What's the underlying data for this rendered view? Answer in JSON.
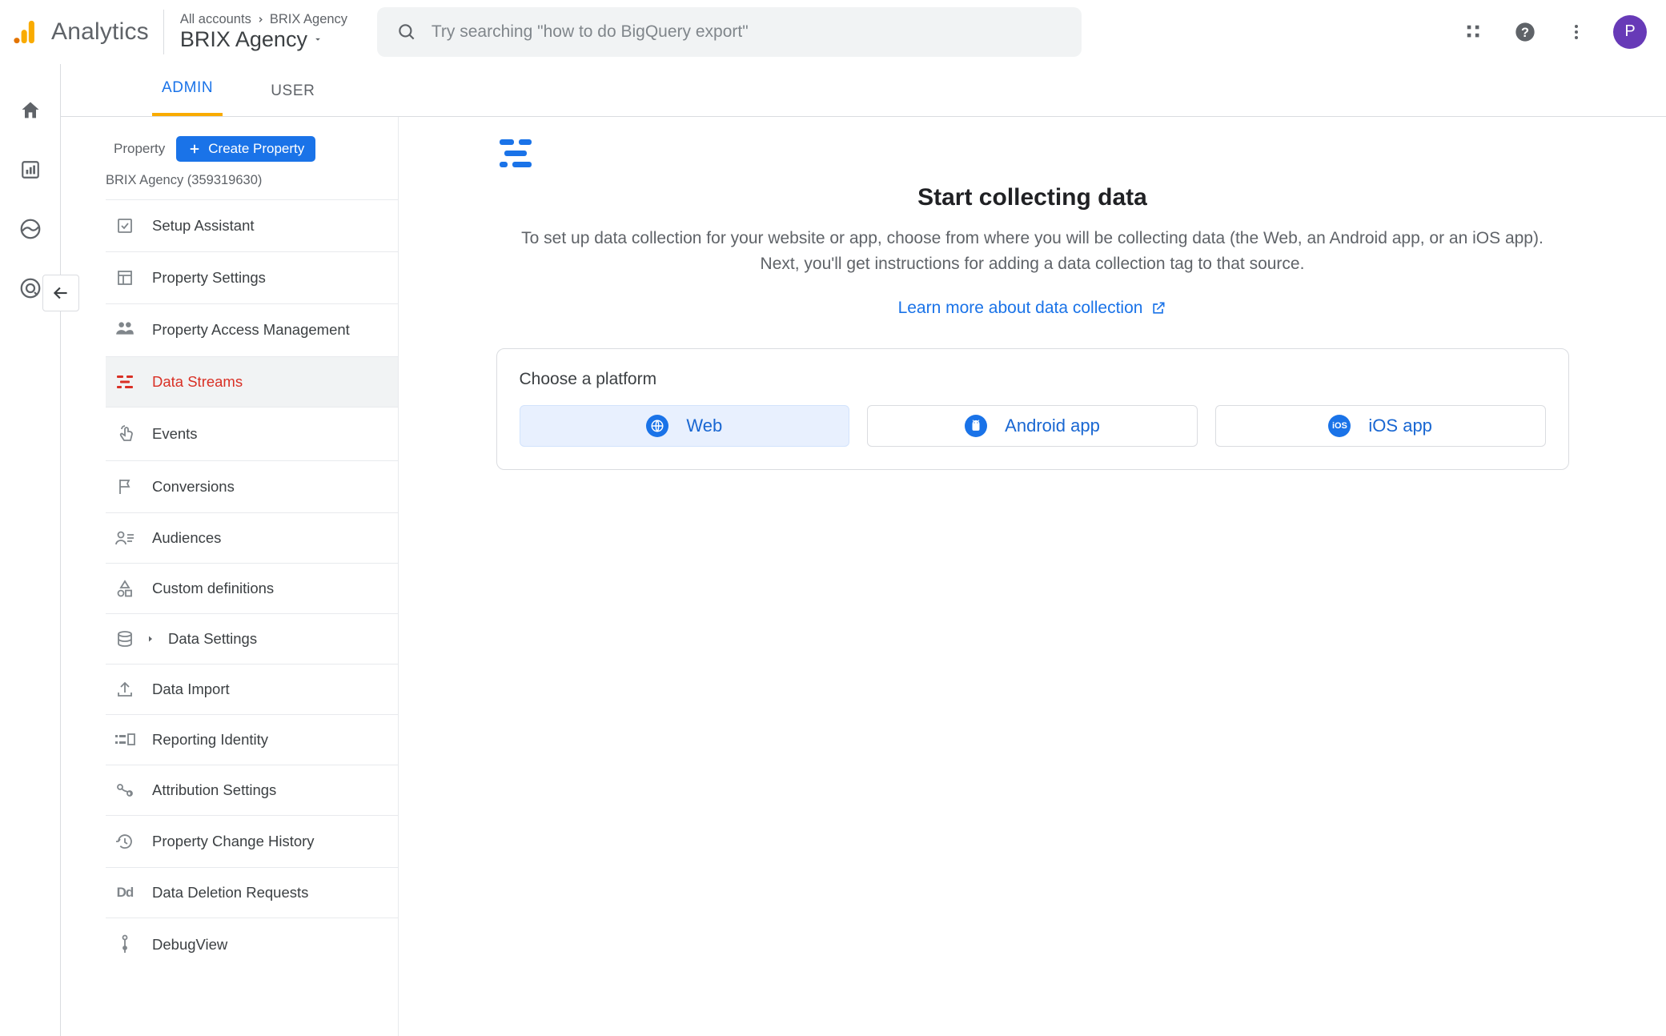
{
  "header": {
    "product": "Analytics",
    "path_all": "All accounts",
    "path_acct": "BRIX Agency",
    "account": "BRIX Agency",
    "search_placeholder": "Try searching \"how to do BigQuery export\"",
    "avatar_initial": "P"
  },
  "tabs": {
    "admin": "ADMIN",
    "user": "USER"
  },
  "property": {
    "label": "Property",
    "create": "Create Property",
    "name": "BRIX Agency (359319630)"
  },
  "menu": {
    "setup_assistant": "Setup Assistant",
    "property_settings": "Property Settings",
    "property_access": "Property Access Management",
    "data_streams": "Data Streams",
    "events": "Events",
    "conversions": "Conversions",
    "audiences": "Audiences",
    "custom_definitions": "Custom definitions",
    "data_settings": "Data Settings",
    "data_import": "Data Import",
    "reporting_identity": "Reporting Identity",
    "attribution_settings": "Attribution Settings",
    "change_history": "Property Change History",
    "deletion_requests": "Data Deletion Requests",
    "debugview": "DebugView"
  },
  "main": {
    "title": "Start collecting data",
    "desc": "To set up data collection for your website or app, choose from where you will be collecting data (the Web, an Android app, or an iOS app). Next, you'll get instructions for adding a data collection tag to that source.",
    "learn_more": "Learn more about data collection",
    "choose": "Choose a platform",
    "web": "Web",
    "android": "Android app",
    "ios": "iOS app"
  }
}
